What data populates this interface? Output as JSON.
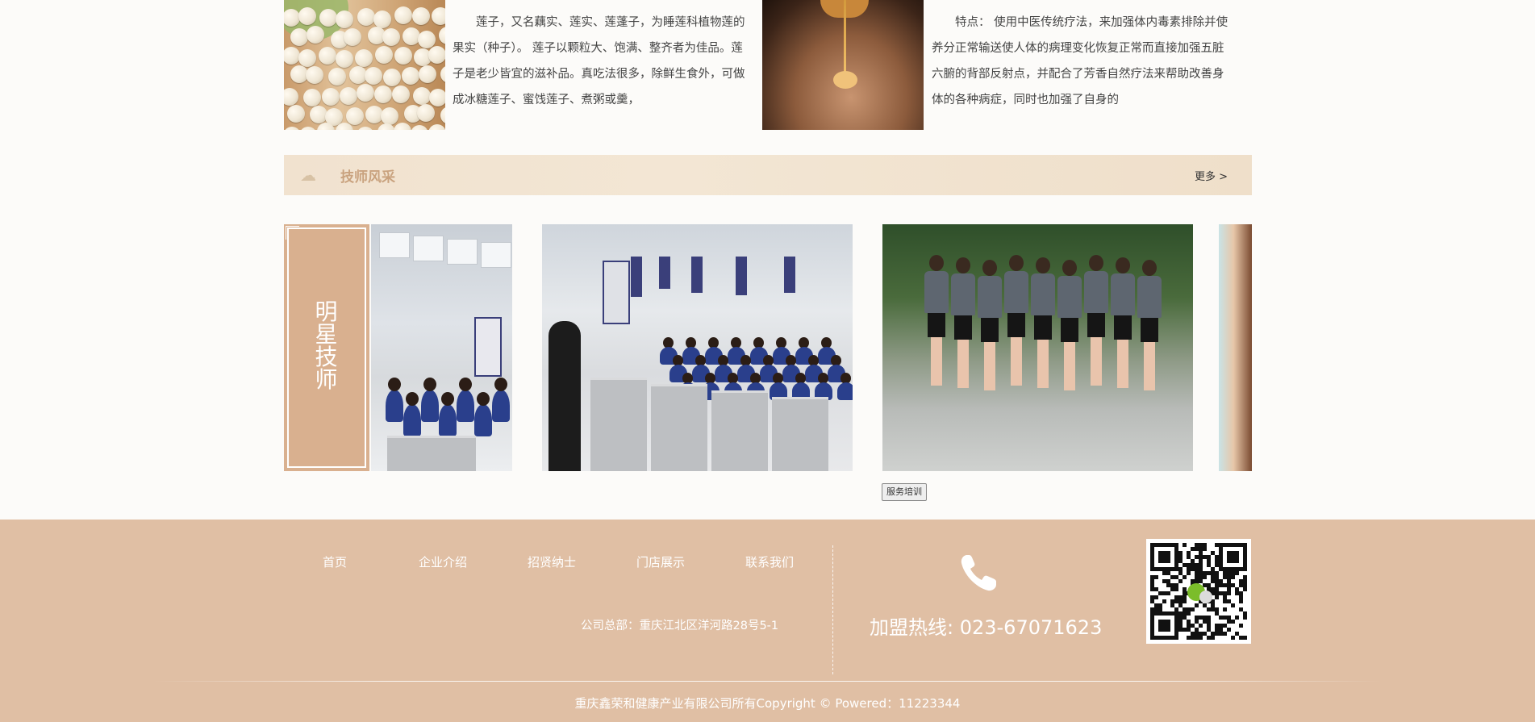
{
  "intro": {
    "lotus_text": "莲子，又名藕实、莲实、莲蓬子，为睡莲科植物莲的果实（种子）。 莲子以颗粒大、饱满、整齐者为佳品。莲子是老少皆宜的滋补品。真吃法很多，除鲜生食外，可做成冰糖莲子、蜜饯莲子、煮粥或羹，",
    "massage_text": "特点： 使用中医传统疗法，来加强体内毒素排除并使养分正常输送使人体的病理变化恢复正常而直接加强五脏六腑的背部反射点，并配合了芳香自然疗法来帮助改善身体的各种病症，同时也加强了自身的"
  },
  "section": {
    "title": "技师风采",
    "more": "更多 >"
  },
  "carousel": {
    "panel_label": [
      "明",
      "星",
      "技",
      "师"
    ],
    "caption_button": "服务培训"
  },
  "footer": {
    "nav": [
      "首页",
      "企业介绍",
      "招贤纳士",
      "门店展示",
      "联系我们"
    ],
    "address": "公司总部：重庆江北区洋河路28号5-1",
    "hotline": "加盟热线: 023-67071623",
    "copyright": "重庆鑫荣和健康产业有限公司所有Copyright © Powered：11223344"
  },
  "icons": {
    "phone": "phone-icon",
    "qr": "qr-code-icon",
    "wechat": "wechat-icon",
    "ornament": "cloud-ornament-icon"
  },
  "colors": {
    "footer_bg": "#e0bfa4",
    "panel_bg": "#d9b08f",
    "section_title": "#c9a27e",
    "page_bg": "#fcfbf9"
  }
}
